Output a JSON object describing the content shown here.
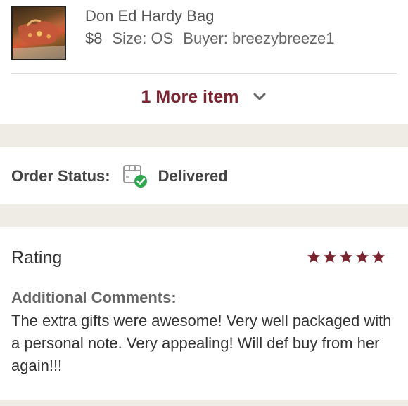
{
  "item": {
    "title": "Don Ed Hardy Bag",
    "price": "$8",
    "size": "Size: OS",
    "buyer": "Buyer: breezybreeze1",
    "thumbnail_icon": "bag-photo"
  },
  "more_items": {
    "label": "1 More item",
    "icon": "chevron-down-icon"
  },
  "order_status": {
    "label": "Order Status:",
    "value": "Delivered",
    "icon": "delivered-box-icon"
  },
  "rating": {
    "label": "Rating",
    "stars": 5,
    "max_stars": 5
  },
  "comments": {
    "label": "Additional Comments:",
    "text": "The extra gifts were awesome! Very well packaged with a personal note. Very appealing! Will def buy from her again!!!"
  },
  "colors": {
    "accent": "#7a2430",
    "check_green": "#2fa84f",
    "background": "#efece6"
  }
}
